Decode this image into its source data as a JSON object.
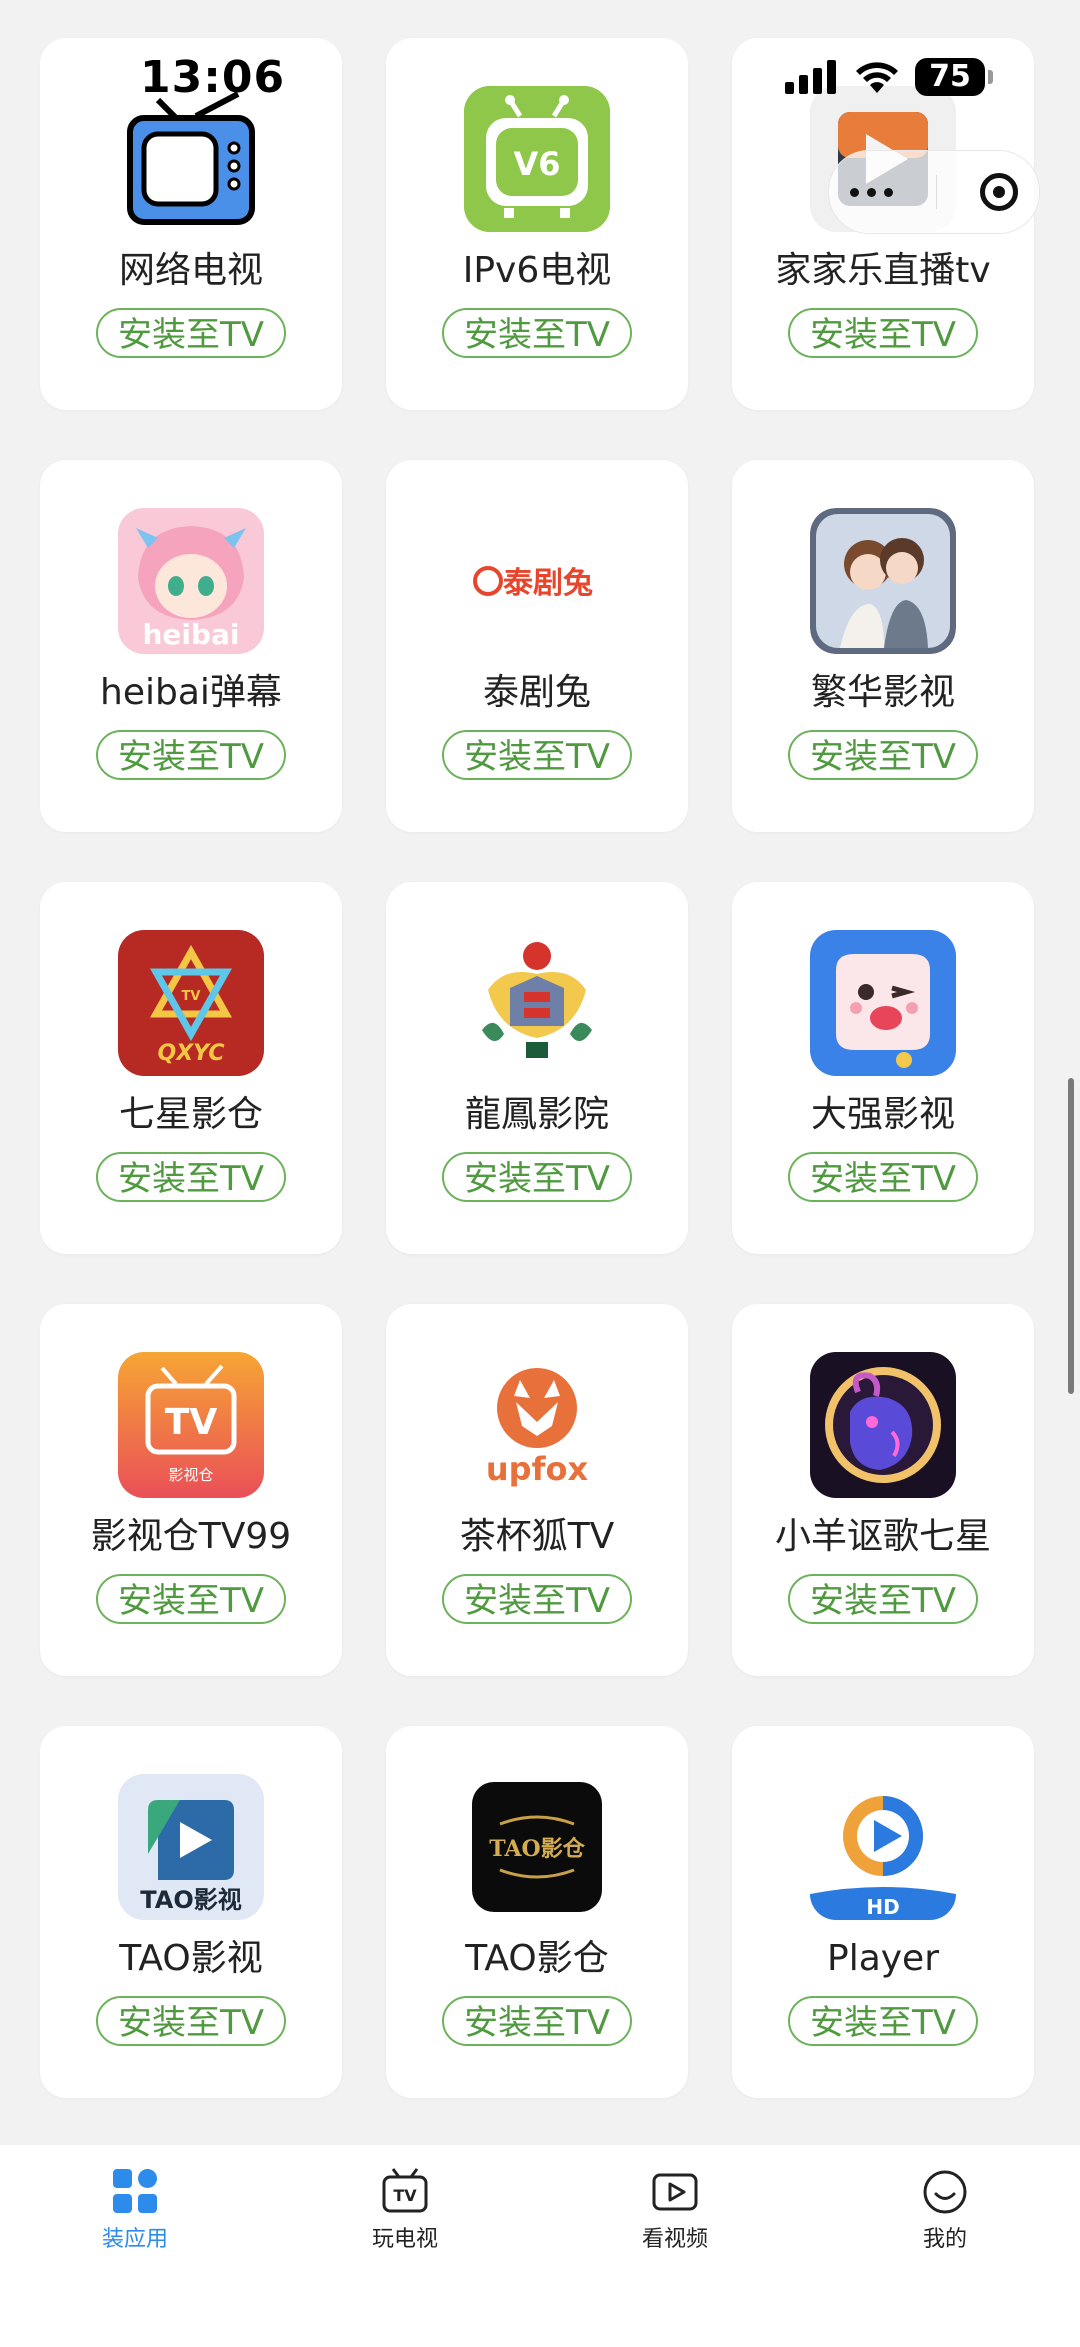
{
  "status_bar": {
    "time": "13:06",
    "battery": "75"
  },
  "install_label": "安装至TV",
  "apps": [
    {
      "name": "网络电视",
      "icon": "retro-tv-icon"
    },
    {
      "name": "IPv6电视",
      "icon": "ipv6-tv-icon",
      "icon_text": "V6"
    },
    {
      "name": "家家乐直播tv",
      "icon": "play-tile-icon"
    },
    {
      "name": "heibai弹幕",
      "icon": "anime-girl-icon",
      "icon_text": "heibai"
    },
    {
      "name": "泰剧兔",
      "icon": "thai-drama-logo-icon",
      "icon_text": "泰剧兔"
    },
    {
      "name": "繁华影视",
      "icon": "couple-illustration-icon"
    },
    {
      "name": "七星影仓",
      "icon": "star-logo-icon",
      "icon_text": "QXYC"
    },
    {
      "name": "龍鳳影院",
      "icon": "dragon-phoenix-icon"
    },
    {
      "name": "大强影视",
      "icon": "cartoon-cube-icon"
    },
    {
      "name": "影视仓TV99",
      "icon": "tv-warehouse-icon",
      "icon_text": "TV"
    },
    {
      "name": "茶杯狐TV",
      "icon": "upfox-icon",
      "icon_text": "upfox"
    },
    {
      "name": "小羊讴歌七星",
      "icon": "goat-icon"
    },
    {
      "name": "TAO影视",
      "icon": "tao-play-icon",
      "icon_text": "TAO影视"
    },
    {
      "name": "TAO影仓",
      "icon": "tao-gold-icon",
      "icon_text": "TAO影仓"
    },
    {
      "name": "Player",
      "icon": "hd-player-icon",
      "icon_text": "HD"
    }
  ],
  "tabs": [
    {
      "label": "装应用",
      "icon": "grid-apps-icon",
      "active": true
    },
    {
      "label": "玩电视",
      "icon": "tv-icon",
      "active": false
    },
    {
      "label": "看视频",
      "icon": "video-play-icon",
      "active": false
    },
    {
      "label": "我的",
      "icon": "smile-face-icon",
      "active": false
    }
  ],
  "colors": {
    "accent_blue": "#2d8ceb",
    "install_green": "#4f9a3f",
    "background": "#f2f2f2"
  }
}
